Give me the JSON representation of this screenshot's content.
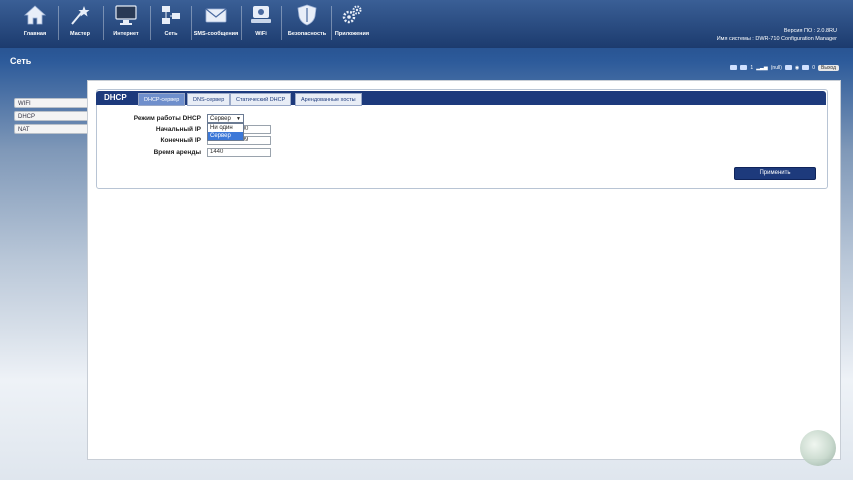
{
  "topnav": {
    "items": [
      {
        "label": "Главная",
        "icon": "home-icon"
      },
      {
        "label": "Мастер",
        "icon": "wizard-icon"
      },
      {
        "label": "Интернет",
        "icon": "monitor-icon"
      },
      {
        "label": "Сеть",
        "icon": "network-icon"
      },
      {
        "label": "SMS-сообщения",
        "icon": "envelope-icon"
      },
      {
        "label": "WiFi",
        "icon": "router-icon"
      },
      {
        "label": "Безопасность",
        "icon": "shield-icon"
      },
      {
        "label": "Приложения",
        "icon": "gears-icon"
      }
    ],
    "firmware_line": "Версия ПО : 2.0.8RU",
    "system_line": "Имя системы : DWR-710 Configuration Manager"
  },
  "page_title": "Сеть",
  "statusbar": {
    "sim_count": "1",
    "network": "(null)",
    "sms_count": "0",
    "logout_label": "Выход"
  },
  "sidebar": {
    "items": [
      {
        "label": "WIFI"
      },
      {
        "label": "DHCP"
      },
      {
        "label": "NAT"
      }
    ]
  },
  "panel": {
    "title": "DHCP",
    "tabs": [
      {
        "label": "DHCP-сервер"
      },
      {
        "label": "DNS-сервер"
      },
      {
        "label": "Статический DHCP"
      },
      {
        "label": "Арендованные хосты"
      }
    ],
    "fields": {
      "mode_label": "Режим работы DHCP",
      "mode_value": "Сервер",
      "mode_options": [
        "Ни один",
        "Сервер"
      ],
      "start_ip_label": "Начальный IP",
      "start_ip_value": "192.168.0.100",
      "end_ip_label": "Конечный IP",
      "end_ip_value": "192.168.0.199",
      "lease_label": "Время аренды",
      "lease_value": "1440"
    },
    "apply_label": "Применить"
  },
  "colors": {
    "toolbar": "#1c3b6e",
    "panel_header": "#1d3a7c",
    "active_tab": "#6f8fcc",
    "selection": "#3c78d8"
  }
}
